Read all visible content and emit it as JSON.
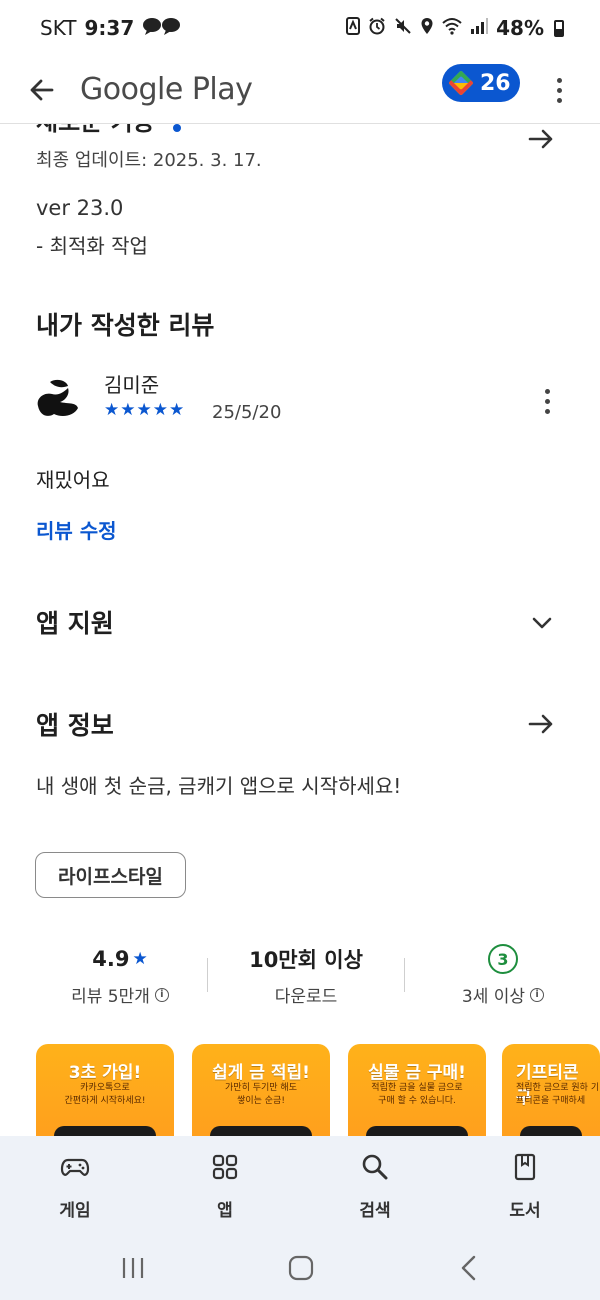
{
  "status_bar": {
    "carrier": "SKT",
    "time": "9:37",
    "battery": "48%"
  },
  "app_bar": {
    "title": "Google Play",
    "points": "26",
    "back_icon": "arrow-back-icon",
    "more_icon": "more-vert-icon"
  },
  "whats_new": {
    "title": "새로운 기능",
    "updated": "최종 업데이트: 2025. 3. 17.",
    "version": "ver 23.0",
    "note": "- 최적화 작업"
  },
  "my_review": {
    "title": "내가 작성한 리뷰",
    "reviewer": "김미준",
    "rating": 5,
    "date": "25/5/20",
    "text": "재밌어요",
    "edit_label": "리뷰 수정"
  },
  "app_support": {
    "title": "앱 지원"
  },
  "app_info": {
    "title": "앱 정보",
    "description": "내 생애 첫 순금, 금캐기 앱으로 시작하세요!",
    "category": "라이프스타일"
  },
  "stats": {
    "rating": "4.9",
    "reviews": "리뷰 5만개",
    "downloads": "10만회 이상",
    "downloads_label": "다운로드",
    "age": "3",
    "age_label": "3세 이상"
  },
  "screenshots": [
    {
      "title": "3초 가입!",
      "sub": "카카오톡으로\n간편하게 시작하세요!"
    },
    {
      "title": "쉽게 금 적립!",
      "sub": "가만히 두기만 해도\n쌓이는 순금!"
    },
    {
      "title": "실물 금 구매!",
      "sub": "적립한 금을 실물 금으로\n구매 할 수 있습니다."
    },
    {
      "title": "기프티콘 구",
      "sub": "적립한 금으로 원하\n기프티콘을 구매하세"
    }
  ],
  "bottom_nav": [
    {
      "label": "게임",
      "icon": "gamepad-icon"
    },
    {
      "label": "앱",
      "icon": "apps-grid-icon"
    },
    {
      "label": "검색",
      "icon": "search-icon"
    },
    {
      "label": "도서",
      "icon": "book-icon"
    }
  ],
  "colors": {
    "accent": "#0b57d0",
    "age_green": "#1e8e3e",
    "screenshot_orange": "#ffa51c",
    "nav_bg": "#eef2f8"
  }
}
